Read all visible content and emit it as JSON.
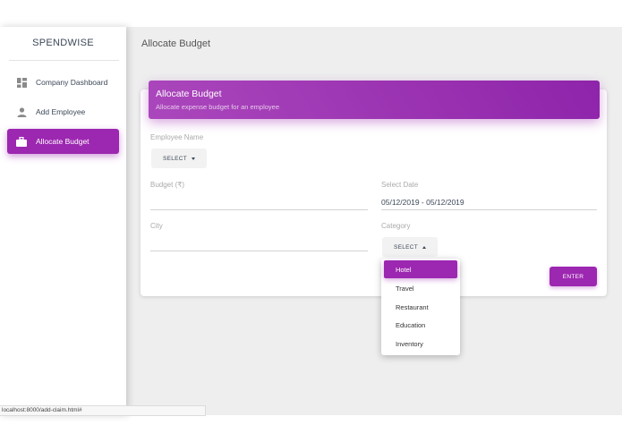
{
  "brand": "SPENDWISE",
  "sidebar": {
    "items": [
      {
        "label": "Company Dashboard",
        "icon": "dashboard-icon",
        "active": false
      },
      {
        "label": "Add Employee",
        "icon": "person-icon",
        "active": false
      },
      {
        "label": "Allocate Budget",
        "icon": "briefcase-icon",
        "active": true
      }
    ]
  },
  "page": {
    "title": "Allocate Budget"
  },
  "card": {
    "title": "Allocate Budget",
    "subtitle": "Allocate expense budget for an employee"
  },
  "form": {
    "employee": {
      "label": "Employee Name",
      "button": "SELECT"
    },
    "budget": {
      "label": "Budget (₹)",
      "value": ""
    },
    "date": {
      "label": "Select Date",
      "value": "05/12/2019 - 05/12/2019"
    },
    "city": {
      "label": "City",
      "value": ""
    },
    "category": {
      "label": "Category",
      "button": "SELECT",
      "options": [
        "Hotel",
        "Travel",
        "Restaurant",
        "Education",
        "Inventory"
      ],
      "highlighted": "Hotel"
    },
    "submit": "ENTER"
  },
  "statusbar": {
    "url": "localhost:8000/add-claim.html#"
  },
  "colors": {
    "accent": "#9c27b0",
    "sidebar_bg": "#ffffff",
    "main_bg": "#eeeeee"
  }
}
